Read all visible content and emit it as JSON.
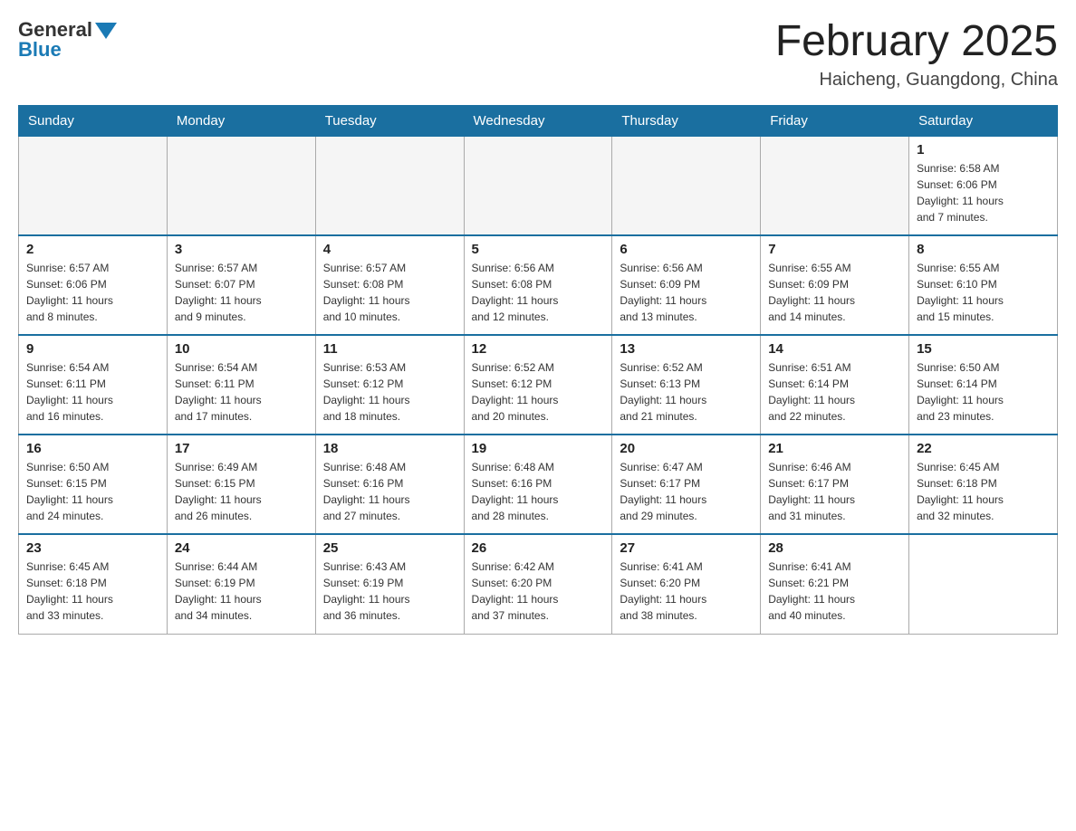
{
  "logo": {
    "general": "General",
    "blue": "Blue"
  },
  "title": "February 2025",
  "subtitle": "Haicheng, Guangdong, China",
  "days_of_week": [
    "Sunday",
    "Monday",
    "Tuesday",
    "Wednesday",
    "Thursday",
    "Friday",
    "Saturday"
  ],
  "weeks": [
    [
      {
        "day": "",
        "info": ""
      },
      {
        "day": "",
        "info": ""
      },
      {
        "day": "",
        "info": ""
      },
      {
        "day": "",
        "info": ""
      },
      {
        "day": "",
        "info": ""
      },
      {
        "day": "",
        "info": ""
      },
      {
        "day": "1",
        "info": "Sunrise: 6:58 AM\nSunset: 6:06 PM\nDaylight: 11 hours\nand 7 minutes."
      }
    ],
    [
      {
        "day": "2",
        "info": "Sunrise: 6:57 AM\nSunset: 6:06 PM\nDaylight: 11 hours\nand 8 minutes."
      },
      {
        "day": "3",
        "info": "Sunrise: 6:57 AM\nSunset: 6:07 PM\nDaylight: 11 hours\nand 9 minutes."
      },
      {
        "day": "4",
        "info": "Sunrise: 6:57 AM\nSunset: 6:08 PM\nDaylight: 11 hours\nand 10 minutes."
      },
      {
        "day": "5",
        "info": "Sunrise: 6:56 AM\nSunset: 6:08 PM\nDaylight: 11 hours\nand 12 minutes."
      },
      {
        "day": "6",
        "info": "Sunrise: 6:56 AM\nSunset: 6:09 PM\nDaylight: 11 hours\nand 13 minutes."
      },
      {
        "day": "7",
        "info": "Sunrise: 6:55 AM\nSunset: 6:09 PM\nDaylight: 11 hours\nand 14 minutes."
      },
      {
        "day": "8",
        "info": "Sunrise: 6:55 AM\nSunset: 6:10 PM\nDaylight: 11 hours\nand 15 minutes."
      }
    ],
    [
      {
        "day": "9",
        "info": "Sunrise: 6:54 AM\nSunset: 6:11 PM\nDaylight: 11 hours\nand 16 minutes."
      },
      {
        "day": "10",
        "info": "Sunrise: 6:54 AM\nSunset: 6:11 PM\nDaylight: 11 hours\nand 17 minutes."
      },
      {
        "day": "11",
        "info": "Sunrise: 6:53 AM\nSunset: 6:12 PM\nDaylight: 11 hours\nand 18 minutes."
      },
      {
        "day": "12",
        "info": "Sunrise: 6:52 AM\nSunset: 6:12 PM\nDaylight: 11 hours\nand 20 minutes."
      },
      {
        "day": "13",
        "info": "Sunrise: 6:52 AM\nSunset: 6:13 PM\nDaylight: 11 hours\nand 21 minutes."
      },
      {
        "day": "14",
        "info": "Sunrise: 6:51 AM\nSunset: 6:14 PM\nDaylight: 11 hours\nand 22 minutes."
      },
      {
        "day": "15",
        "info": "Sunrise: 6:50 AM\nSunset: 6:14 PM\nDaylight: 11 hours\nand 23 minutes."
      }
    ],
    [
      {
        "day": "16",
        "info": "Sunrise: 6:50 AM\nSunset: 6:15 PM\nDaylight: 11 hours\nand 24 minutes."
      },
      {
        "day": "17",
        "info": "Sunrise: 6:49 AM\nSunset: 6:15 PM\nDaylight: 11 hours\nand 26 minutes."
      },
      {
        "day": "18",
        "info": "Sunrise: 6:48 AM\nSunset: 6:16 PM\nDaylight: 11 hours\nand 27 minutes."
      },
      {
        "day": "19",
        "info": "Sunrise: 6:48 AM\nSunset: 6:16 PM\nDaylight: 11 hours\nand 28 minutes."
      },
      {
        "day": "20",
        "info": "Sunrise: 6:47 AM\nSunset: 6:17 PM\nDaylight: 11 hours\nand 29 minutes."
      },
      {
        "day": "21",
        "info": "Sunrise: 6:46 AM\nSunset: 6:17 PM\nDaylight: 11 hours\nand 31 minutes."
      },
      {
        "day": "22",
        "info": "Sunrise: 6:45 AM\nSunset: 6:18 PM\nDaylight: 11 hours\nand 32 minutes."
      }
    ],
    [
      {
        "day": "23",
        "info": "Sunrise: 6:45 AM\nSunset: 6:18 PM\nDaylight: 11 hours\nand 33 minutes."
      },
      {
        "day": "24",
        "info": "Sunrise: 6:44 AM\nSunset: 6:19 PM\nDaylight: 11 hours\nand 34 minutes."
      },
      {
        "day": "25",
        "info": "Sunrise: 6:43 AM\nSunset: 6:19 PM\nDaylight: 11 hours\nand 36 minutes."
      },
      {
        "day": "26",
        "info": "Sunrise: 6:42 AM\nSunset: 6:20 PM\nDaylight: 11 hours\nand 37 minutes."
      },
      {
        "day": "27",
        "info": "Sunrise: 6:41 AM\nSunset: 6:20 PM\nDaylight: 11 hours\nand 38 minutes."
      },
      {
        "day": "28",
        "info": "Sunrise: 6:41 AM\nSunset: 6:21 PM\nDaylight: 11 hours\nand 40 minutes."
      },
      {
        "day": "",
        "info": ""
      }
    ]
  ]
}
